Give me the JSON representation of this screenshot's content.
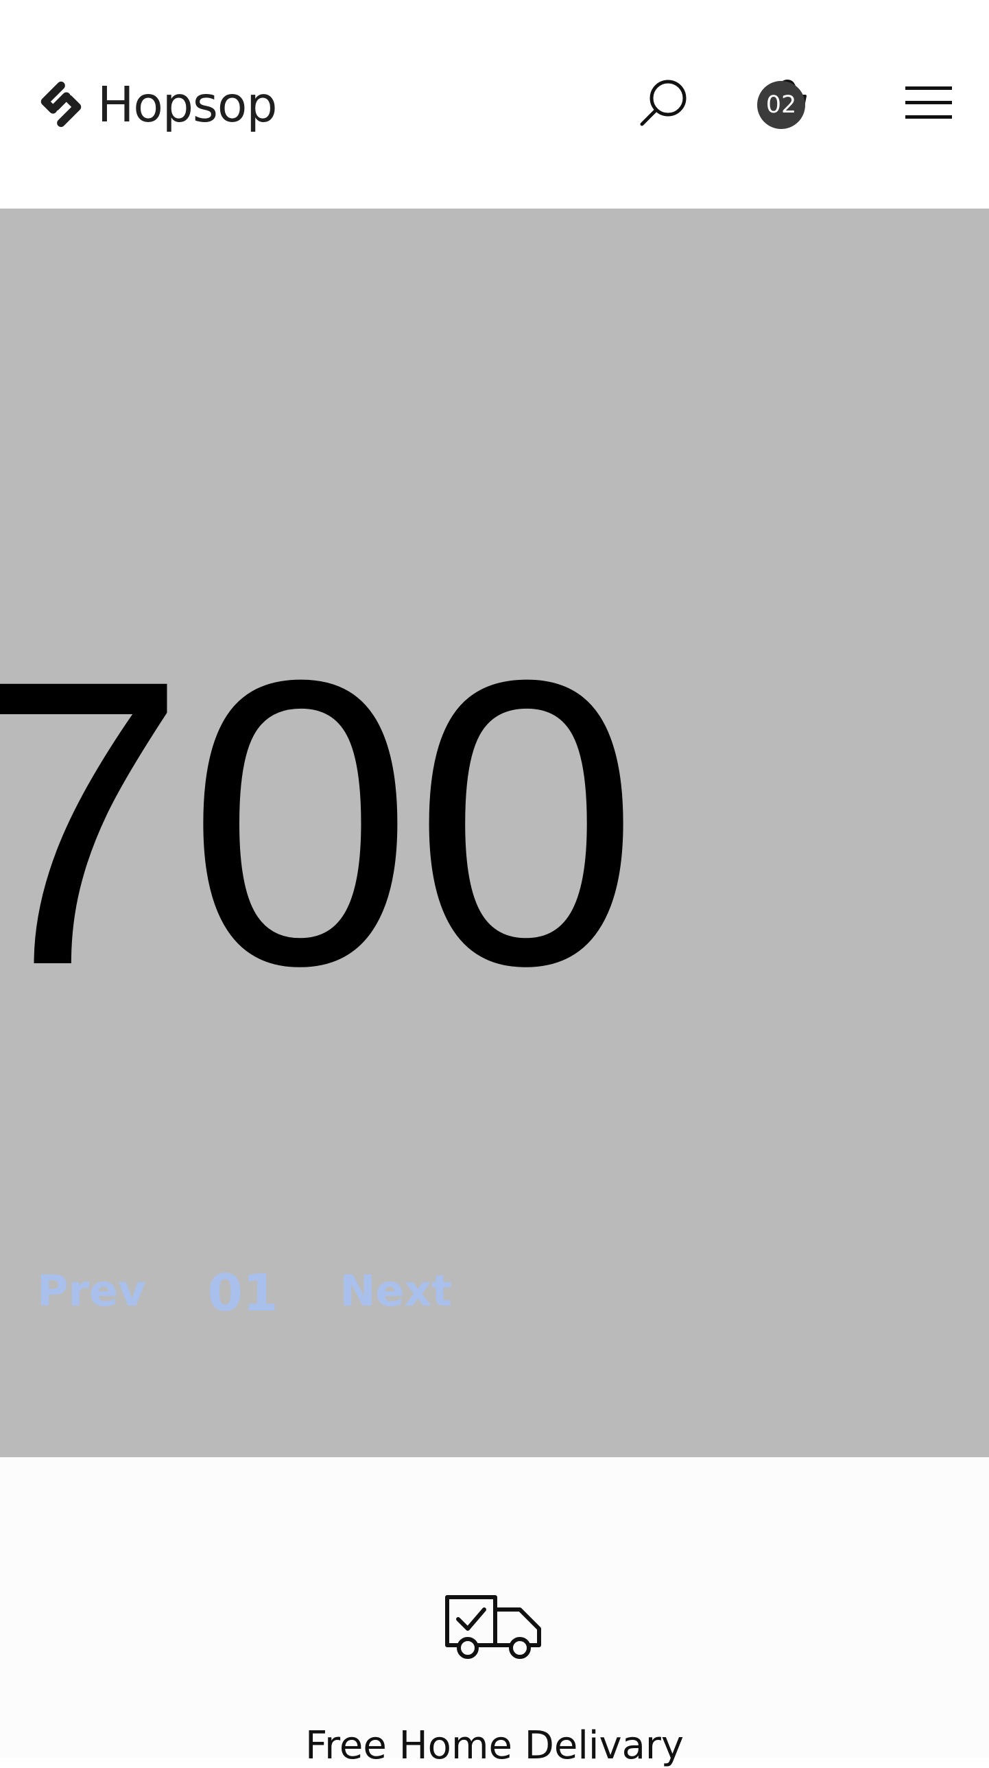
{
  "header": {
    "brand": "Hopsop",
    "cart_count": "02",
    "icons": [
      "hopsop-logo-icon",
      "search-icon",
      "cart-icon",
      "hamburger-menu-icon"
    ]
  },
  "hero": {
    "number_text": "700",
    "pager": {
      "prev_label": "Prev",
      "current": "01",
      "next_label": "Next"
    }
  },
  "features": {
    "items": [
      {
        "icon": "delivery-truck-icon",
        "title": "Free Home Delivary"
      }
    ]
  },
  "colors": {
    "hero_background": "#bababa",
    "pager_text": "#a9c0ec",
    "badge_background": "#3b3b3b",
    "page_background": "#ffffff"
  }
}
